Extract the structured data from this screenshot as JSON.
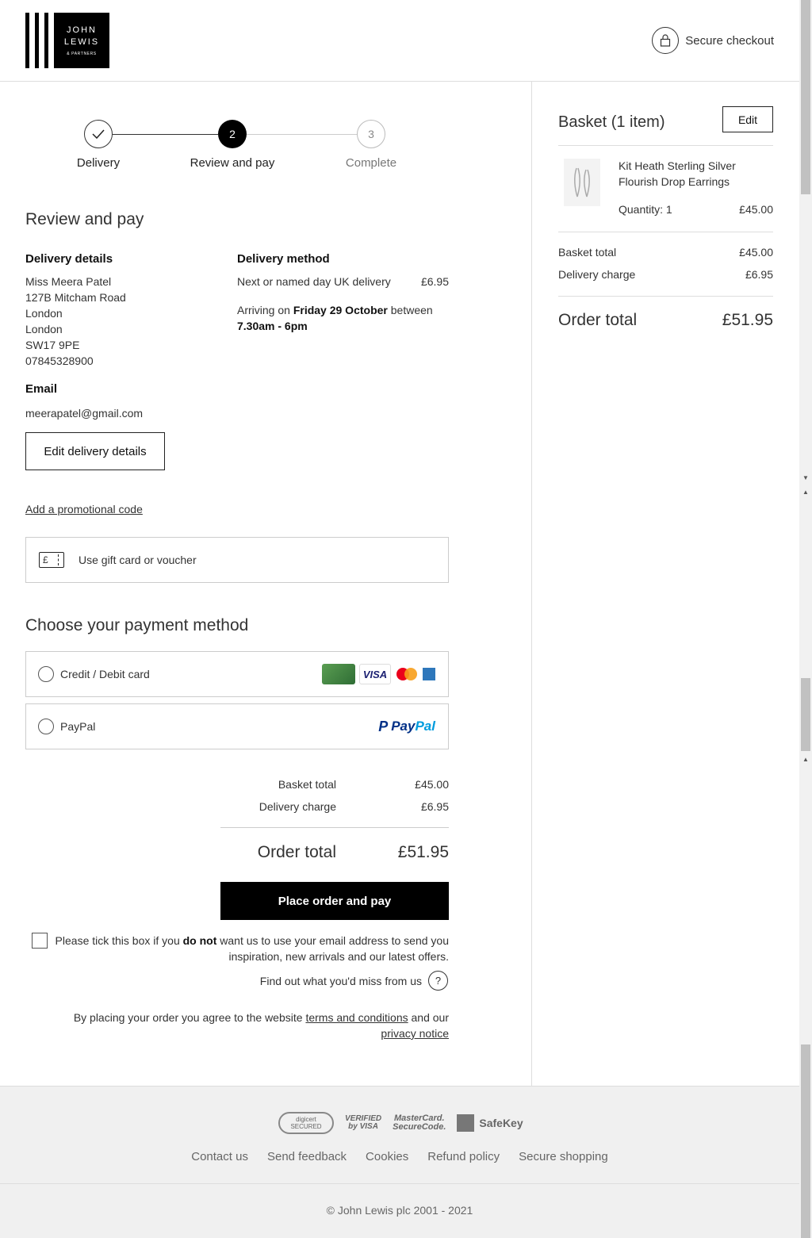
{
  "header": {
    "logo": {
      "line1": "JOHN",
      "line2": "LEWIS",
      "line3": "& PARTNERS"
    },
    "secure_label": "Secure checkout"
  },
  "steps": [
    {
      "number": "",
      "label": "Delivery",
      "state": "done"
    },
    {
      "number": "2",
      "label": "Review and pay",
      "state": "current"
    },
    {
      "number": "3",
      "label": "Complete",
      "state": "upcoming"
    }
  ],
  "review": {
    "title": "Review and pay",
    "delivery_details": {
      "heading": "Delivery details",
      "lines": [
        "Miss Meera Patel",
        "127B Mitcham Road",
        "London",
        "London",
        "SW17 9PE",
        "07845328900"
      ]
    },
    "email": {
      "heading": "Email",
      "value": "meerapatel@gmail.com"
    },
    "delivery_method": {
      "heading": "Delivery method",
      "name": "Next or named day UK delivery",
      "price": "£6.95",
      "arriving_prefix": "Arriving on ",
      "arriving_date": "Friday 29 October",
      "arriving_mid": " between",
      "arriving_time": "7.30am - 6pm"
    },
    "edit_button": "Edit delivery details",
    "promo_link": "Add a promotional code",
    "gift_label": "Use gift card or voucher",
    "gift_icon_symbol": "£"
  },
  "payment": {
    "title": "Choose your payment method",
    "options": [
      {
        "label": "Credit / Debit card"
      },
      {
        "label": "PayPal"
      }
    ],
    "visa_text": "VISA",
    "paypal_text_1": "Pay",
    "paypal_text_2": "Pal"
  },
  "totals": {
    "basket_label": "Basket total",
    "basket_value": "£45.00",
    "delivery_label": "Delivery charge",
    "delivery_value": "£6.95",
    "order_label": "Order total",
    "order_value": "£51.95"
  },
  "place_order": "Place order and pay",
  "optout": {
    "pre": "Please tick this box if you ",
    "bold": "do not",
    "post": " want us to use your email address to send you inspiration, new arrivals and our latest offers."
  },
  "findout": "Find out what you'd miss from us",
  "legal": {
    "pre": "By placing your order you agree to the website ",
    "terms": "terms and conditions",
    "mid": " and our ",
    "privacy": "privacy notice"
  },
  "basket": {
    "title": "Basket (1 item)",
    "edit": "Edit",
    "product_name": "Kit Heath Sterling Silver Flourish Drop Earrings",
    "quantity": "Quantity: 1",
    "price": "£45.00",
    "basket_label": "Basket total",
    "basket_value": "£45.00",
    "delivery_label": "Delivery charge",
    "delivery_value": "£6.95",
    "order_label": "Order total",
    "order_value": "£51.95"
  },
  "footer": {
    "badges": {
      "digicert": "digicert SECURED",
      "verified_1": "VERIFIED",
      "verified_2": "by VISA",
      "mc_1": "MasterCard.",
      "mc_2": "SecureCode.",
      "safekey": "SafeKey"
    },
    "links": [
      "Contact us",
      "Send feedback",
      "Cookies",
      "Refund policy",
      "Secure shopping"
    ],
    "copyright": "© John Lewis plc 2001 - 2021"
  }
}
